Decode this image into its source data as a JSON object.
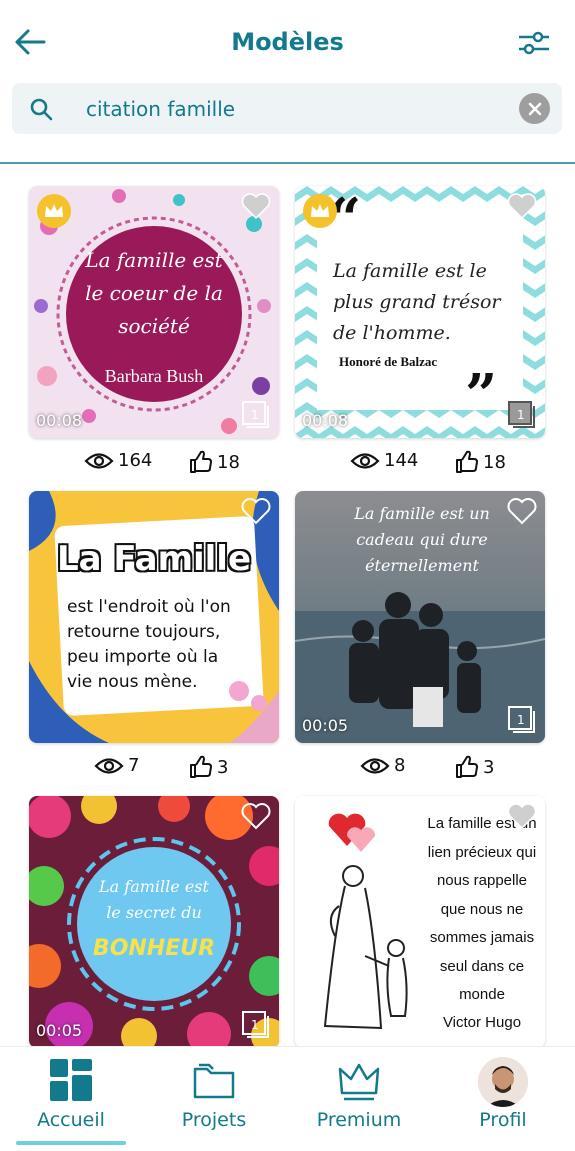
{
  "header": {
    "title": "Modèles"
  },
  "search": {
    "query": "citation famille"
  },
  "cards": [
    {
      "quote": "La famille est le coeur de la société",
      "author": "Barbara Bush",
      "duration": "00:08",
      "pages": "1",
      "views": "164",
      "likes": "18"
    },
    {
      "quote": "La famille est le plus grand trésor de l'homme.",
      "author": "Honoré de Balzac",
      "duration": "00:08",
      "pages": "1",
      "views": "144",
      "likes": "18"
    },
    {
      "title": "La Famille",
      "quote": "est l'endroit où l'on retourne toujours, peu importe où la vie nous mène.",
      "views": "7",
      "likes": "3"
    },
    {
      "quote": "La famille est un cadeau qui dure éternellement",
      "duration": "00:05",
      "pages": "1",
      "views": "8",
      "likes": "3"
    },
    {
      "quote": "La famille est le secret du",
      "highlight": "BONHEUR",
      "duration": "00:05",
      "pages": "1"
    },
    {
      "quote": "La famille est un lien précieux qui nous rappelle que nous ne sommes jamais seul dans ce monde",
      "author": "Victor Hugo"
    }
  ],
  "nav": [
    {
      "label": "Accueil",
      "icon": "home-grid-icon",
      "active": true
    },
    {
      "label": "Projets",
      "icon": "folder-icon"
    },
    {
      "label": "Premium",
      "icon": "crown-icon"
    },
    {
      "label": "Profil",
      "icon": "avatar"
    }
  ],
  "colors": {
    "accent": "#127a8c",
    "crown": "#f4c22b",
    "activeBar": "#6ecfe0"
  }
}
